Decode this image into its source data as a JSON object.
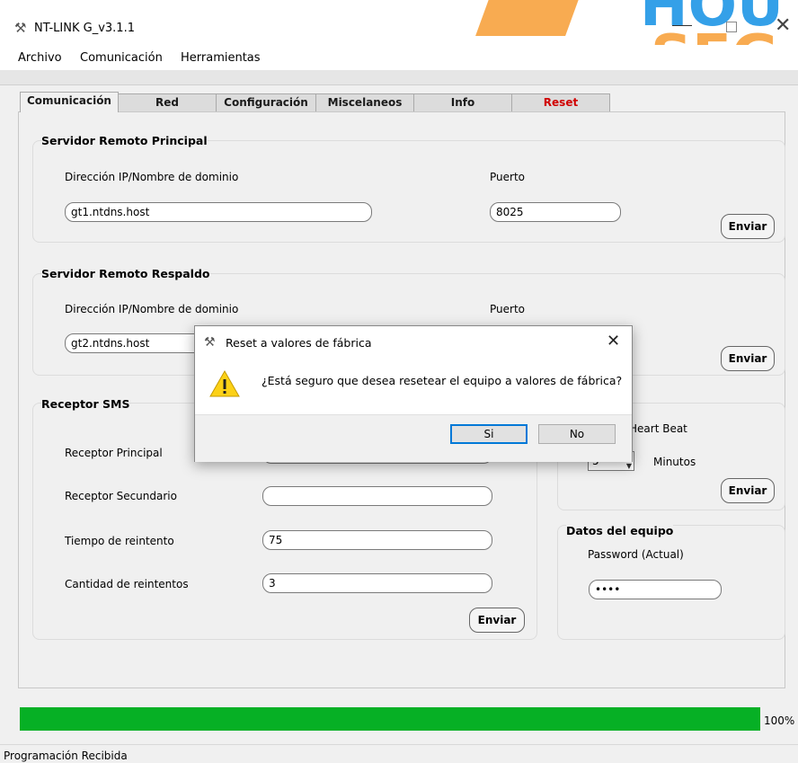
{
  "window": {
    "title": "NT-LINK G_v3.1.1"
  },
  "menu": {
    "items": [
      "Archivo",
      "Comunicación",
      "Herramientas"
    ]
  },
  "tabs": [
    "Comunicación",
    "Red",
    "Configuración",
    "Miscelaneos",
    "Info",
    "Reset"
  ],
  "remote_primary": {
    "title": "Servidor Remoto Principal",
    "ip_label": "Dirección IP/Nombre de dominio",
    "ip_value": "gt1.ntdns.host",
    "port_label": "Puerto",
    "port_value": "8025",
    "send_label": "Enviar"
  },
  "remote_backup": {
    "title": "Servidor Remoto Respaldo",
    "ip_label": "Dirección IP/Nombre de dominio",
    "ip_value": "gt2.ntdns.host",
    "port_label": "Puerto",
    "send_label": "Enviar"
  },
  "sms": {
    "title": "Receptor SMS",
    "primary_label": "Receptor Principal",
    "secondary_label": "Receptor Secundario",
    "retry_time_label": "Tiempo de reintento",
    "retry_time_value": "75",
    "retry_count_label": "Cantidad de reintentos",
    "retry_count_value": "3",
    "send_label": "Enviar"
  },
  "heartbeat": {
    "label": "Heart Beat",
    "value": "5",
    "unit": "Minutos",
    "send_label": "Enviar"
  },
  "device": {
    "title": "Datos del equipo",
    "password_label": "Password (Actual)",
    "password_value": "••••"
  },
  "progress": {
    "value": 1.0,
    "label": "100%"
  },
  "status": {
    "text": "Programación Recibida"
  },
  "dialog": {
    "title": "Reset a valores de fábrica",
    "message": "¿Está seguro que desea resetear el equipo a valores de fábrica?",
    "yes_label": "Si",
    "no_label": "No"
  },
  "colors": {
    "progress": "#06b025",
    "reset_tab": "#d00000",
    "watermark": "#f79c32"
  }
}
